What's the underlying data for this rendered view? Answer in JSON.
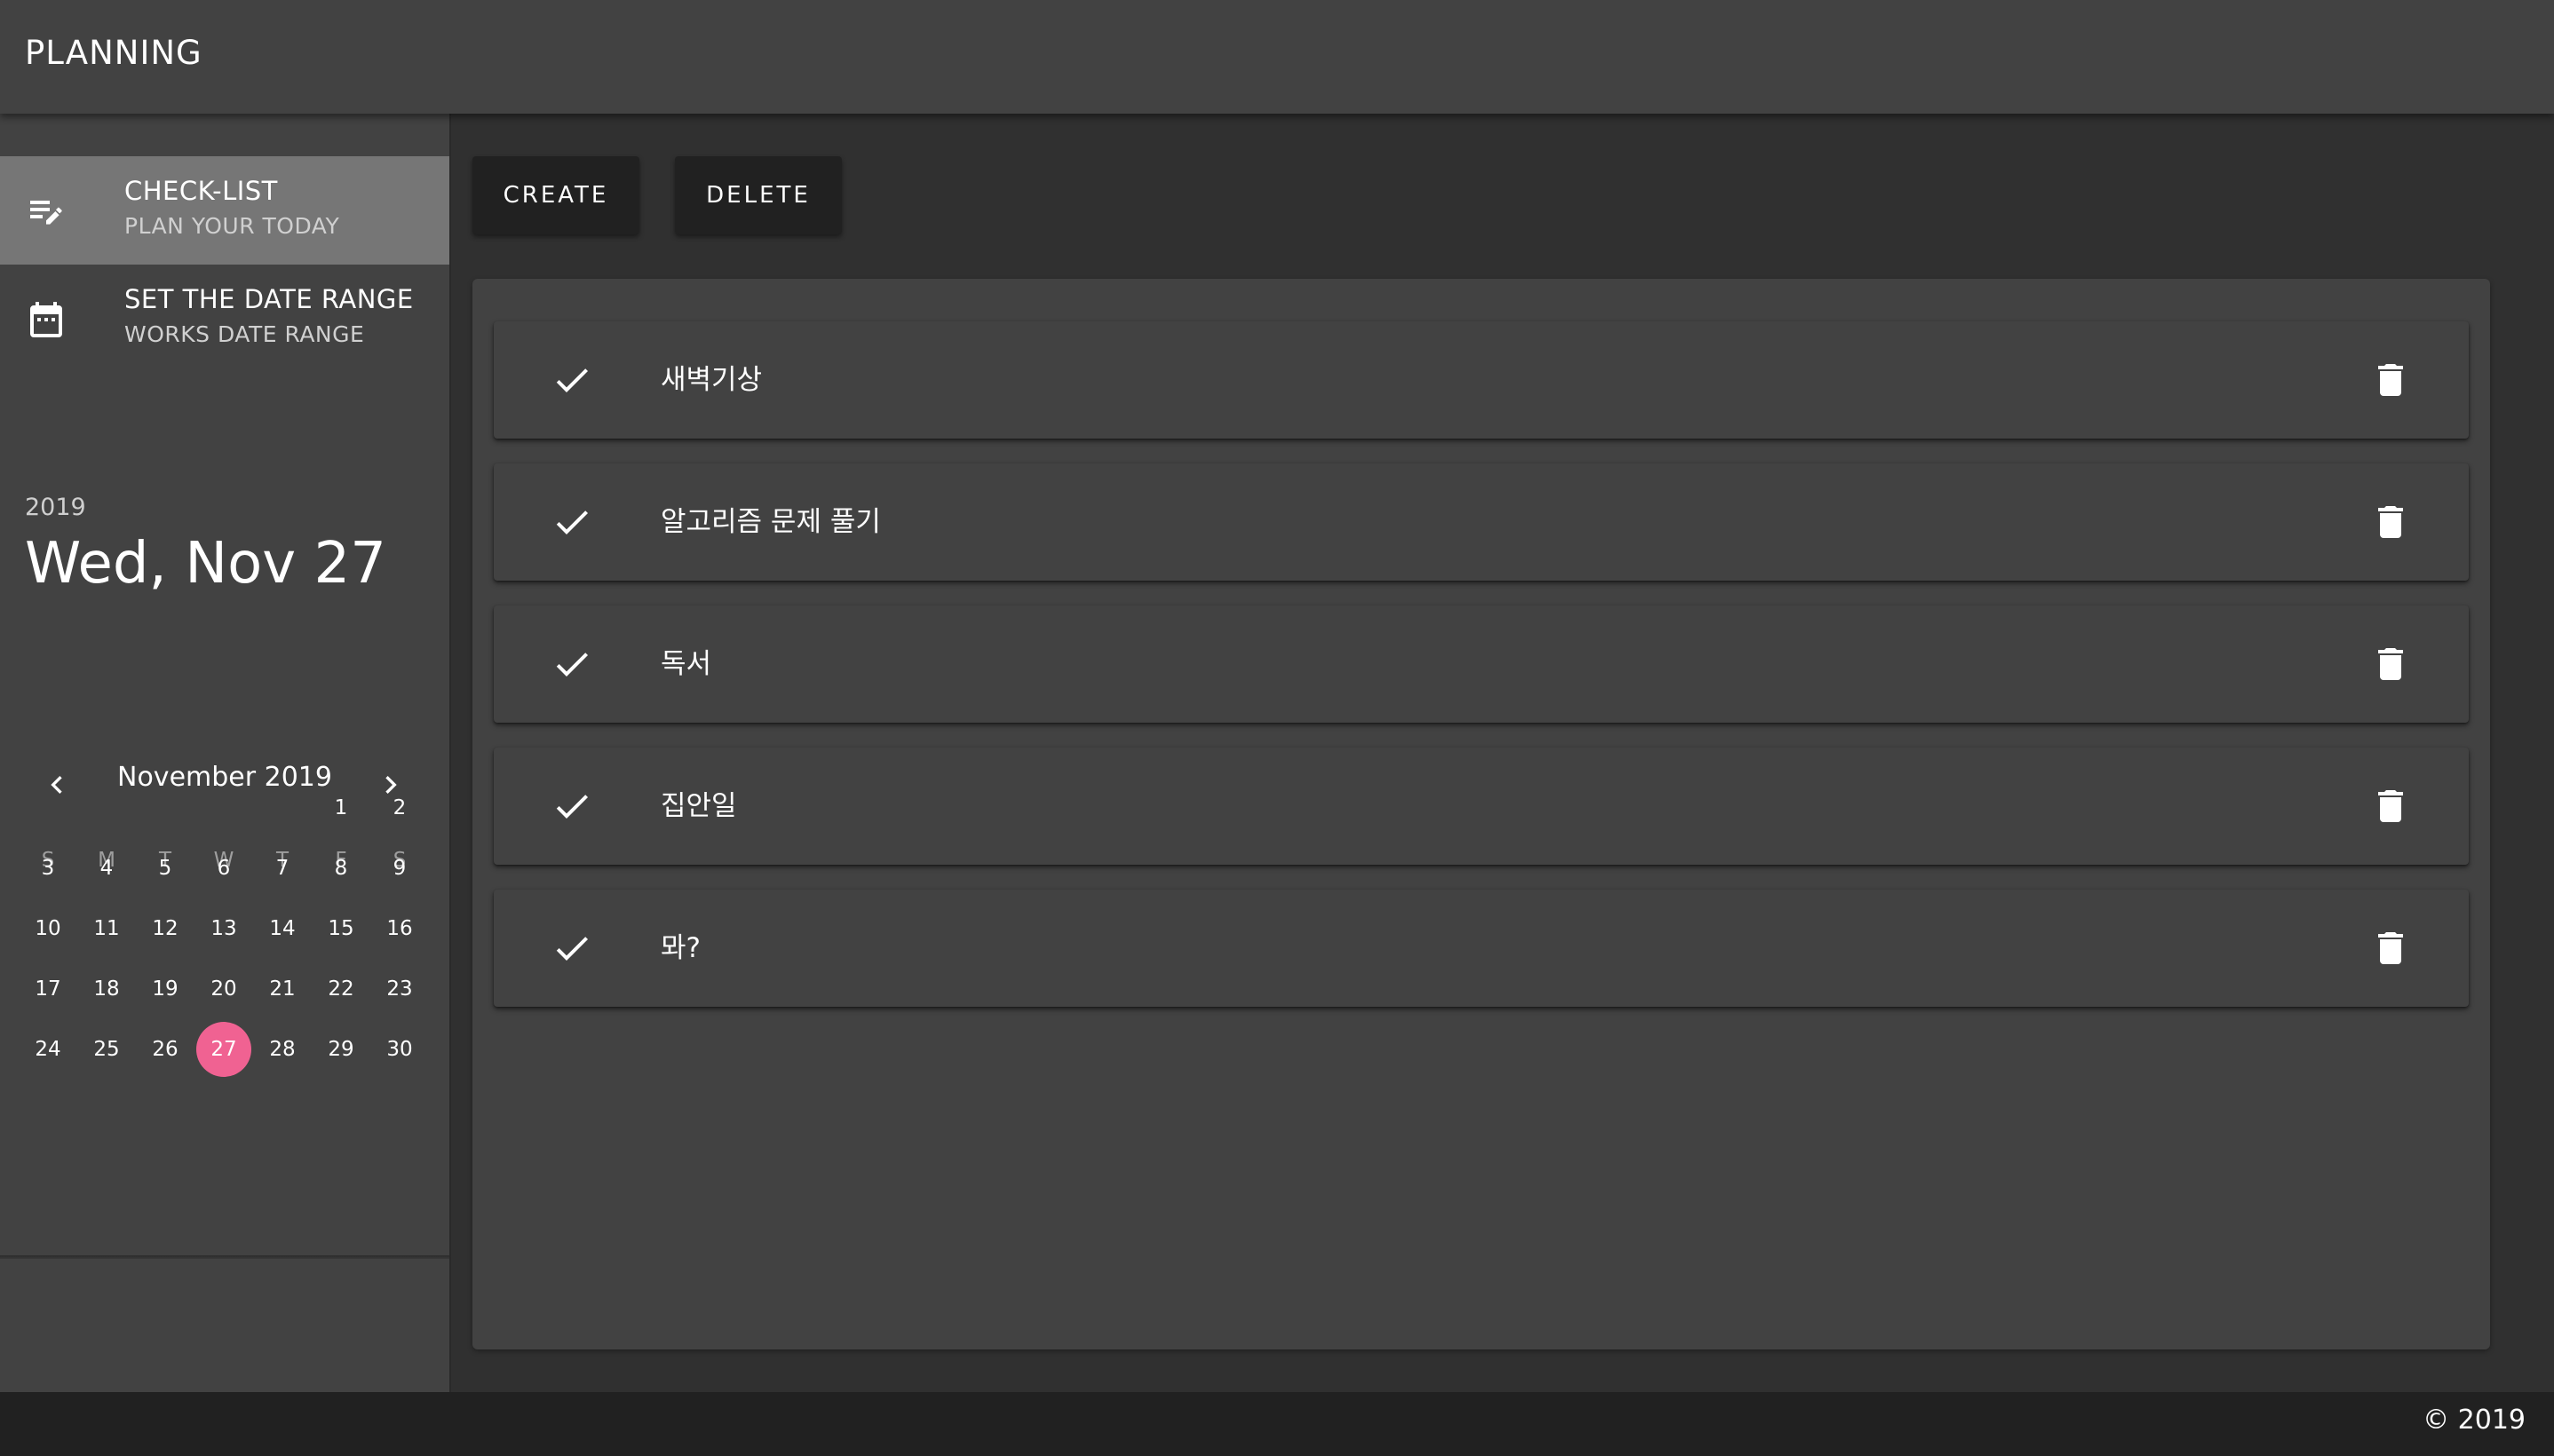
{
  "appbar": {
    "title": "PLANNING"
  },
  "sidebar": {
    "items": [
      {
        "primary": "CHECK-LIST",
        "secondary": "PLAN YOUR TODAY",
        "icon": "playlist-edit-icon",
        "active": true
      },
      {
        "primary": "SET THE DATE RANGE",
        "secondary": "WORKS DATE RANGE",
        "icon": "calendar-icon",
        "active": false
      }
    ]
  },
  "picker": {
    "year": "2019",
    "date": "Wed, Nov 27",
    "month_label": "November 2019",
    "weekdays": [
      "S",
      "M",
      "T",
      "W",
      "T",
      "F",
      "S"
    ],
    "days": [
      "1",
      "2",
      "3",
      "4",
      "5",
      "6",
      "7",
      "8",
      "9",
      "10",
      "11",
      "12",
      "13",
      "14",
      "15",
      "16",
      "17",
      "18",
      "19",
      "20",
      "21",
      "22",
      "23",
      "24",
      "25",
      "26",
      "27",
      "28",
      "29",
      "30"
    ],
    "selected_day": "27",
    "accent_color": "#f06292"
  },
  "toolbar": {
    "create_label": "CREATE",
    "delete_label": "DELETE"
  },
  "todos": [
    {
      "text": "새벽기상"
    },
    {
      "text": "알고리즘 문제 풀기"
    },
    {
      "text": "독서"
    },
    {
      "text": "집안일"
    },
    {
      "text": "뫄?"
    }
  ],
  "footer": {
    "text": "© 2019"
  },
  "colors": {
    "background": "#303030",
    "surface": "#424242",
    "active_item": "#767676",
    "button": "#212121",
    "footer": "#212121"
  }
}
